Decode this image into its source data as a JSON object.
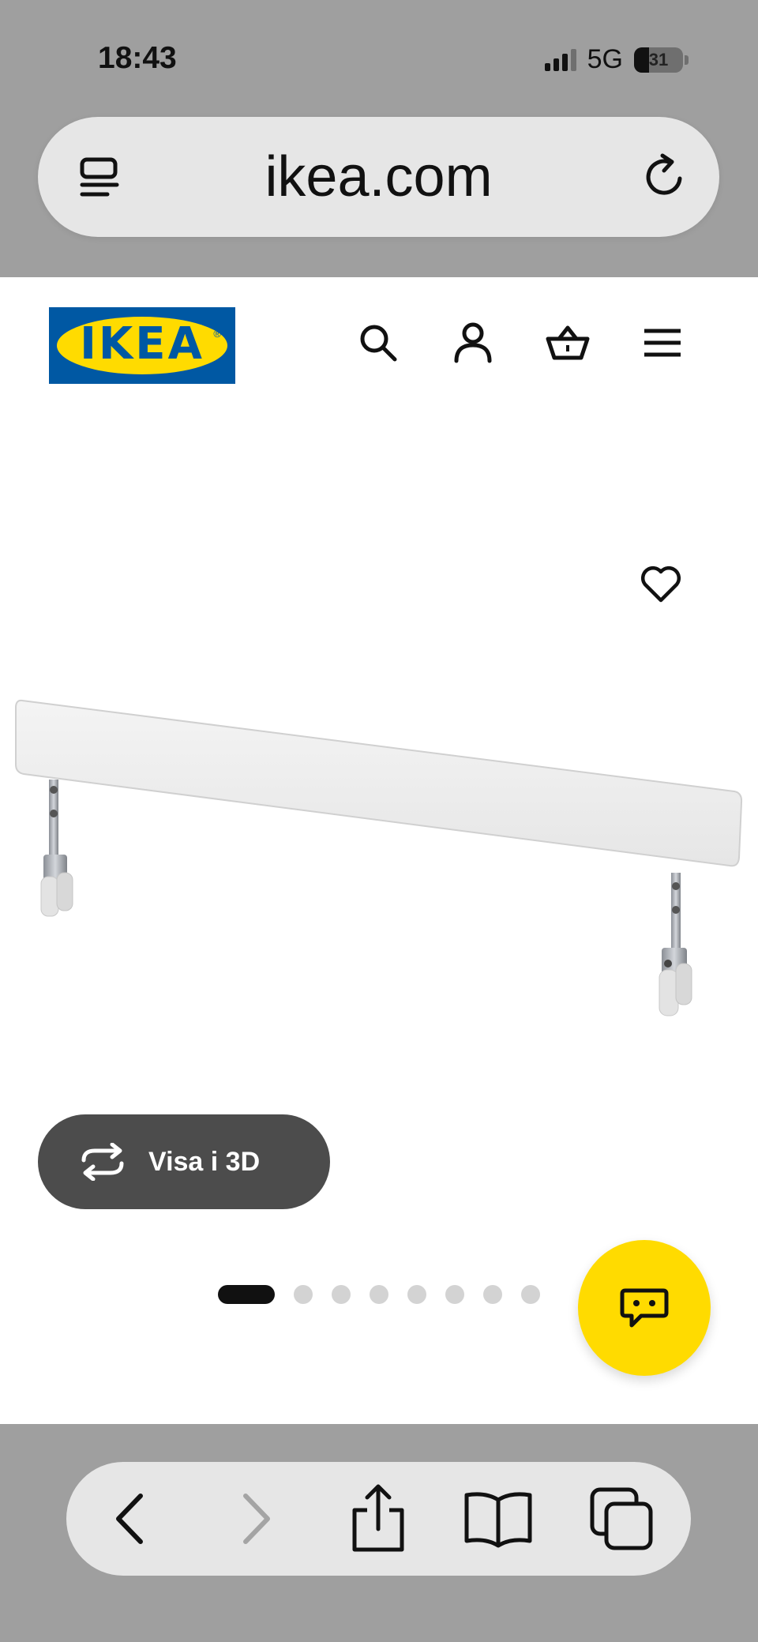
{
  "status_bar": {
    "time": "18:43",
    "network": "5G",
    "battery": "31",
    "battery_level": 0.31
  },
  "browser": {
    "url": "ikea.com"
  },
  "header": {
    "logo_text": "IKEA",
    "icons": [
      "search-icon",
      "account-icon",
      "cart-icon",
      "menu-icon"
    ]
  },
  "product": {
    "favorite_icon": "heart-outline-icon",
    "view_3d_label": "Visa i 3D",
    "gallery": {
      "total": 8,
      "active_index": 0
    }
  },
  "chat": {
    "icon": "chat-bubble-icon",
    "color": "#ffdb00"
  },
  "toolbar": {
    "icons": [
      "back-icon",
      "forward-icon",
      "share-icon",
      "bookmarks-icon",
      "tabs-icon"
    ]
  },
  "colors": {
    "ikea_blue": "#0058a3",
    "ikea_yellow": "#ffdb00",
    "chrome_gray": "#9f9f9f",
    "button_dark": "#4c4c4c"
  }
}
